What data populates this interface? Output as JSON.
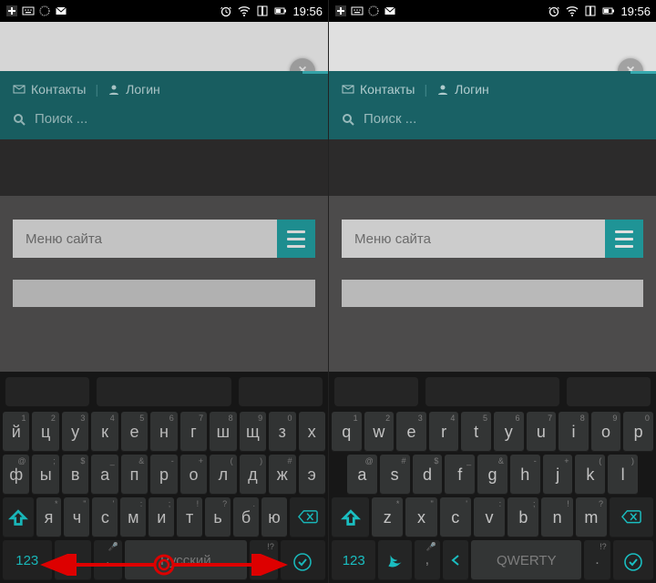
{
  "status": {
    "time": "19:56",
    "icons": {
      "plus": "+",
      "keyboard": "⌨",
      "circle": "◎",
      "mail": "✉",
      "alarm": "⏰",
      "wifi": "wifi",
      "signal": "📶",
      "sq": "▢",
      "bat": "🔋"
    }
  },
  "browser": {
    "close_label": "×"
  },
  "header": {
    "contacts": "Контакты",
    "login": "Логин",
    "search_placeholder": "Поиск ..."
  },
  "menu": {
    "label": "Меню сайта"
  },
  "keyboards": {
    "ru": {
      "row1": [
        {
          "l": "й",
          "s": "1"
        },
        {
          "l": "ц",
          "s": "2"
        },
        {
          "l": "у",
          "s": "3"
        },
        {
          "l": "к",
          "s": "4"
        },
        {
          "l": "е",
          "s": "5"
        },
        {
          "l": "н",
          "s": "6"
        },
        {
          "l": "г",
          "s": "7"
        },
        {
          "l": "ш",
          "s": "8"
        },
        {
          "l": "щ",
          "s": "9"
        },
        {
          "l": "з",
          "s": "0"
        },
        {
          "l": "х",
          "s": ""
        }
      ],
      "row2": [
        {
          "l": "ф",
          "s": "@"
        },
        {
          "l": "ы",
          "s": ";"
        },
        {
          "l": "в",
          "s": "$"
        },
        {
          "l": "а",
          "s": "_"
        },
        {
          "l": "п",
          "s": "&"
        },
        {
          "l": "р",
          "s": "-"
        },
        {
          "l": "о",
          "s": "+"
        },
        {
          "l": "л",
          "s": "("
        },
        {
          "l": "д",
          "s": ")"
        },
        {
          "l": "ж",
          "s": "#"
        },
        {
          "l": "э",
          "s": ""
        }
      ],
      "row3": [
        {
          "l": "я",
          "s": "*"
        },
        {
          "l": "ч",
          "s": "\""
        },
        {
          "l": "с",
          "s": "'"
        },
        {
          "l": "м",
          "s": ":"
        },
        {
          "l": "и",
          "s": ";"
        },
        {
          "l": "т",
          "s": "!"
        },
        {
          "l": "ь",
          "s": "?"
        },
        {
          "l": "б",
          "s": "."
        },
        {
          "l": "ю",
          "s": ""
        }
      ],
      "space": "Русский",
      "sym": "123",
      "rowB": {
        "comma": ",",
        "period": ".",
        "ques": "!?"
      }
    },
    "en": {
      "row1": [
        {
          "l": "q",
          "s": "1"
        },
        {
          "l": "w",
          "s": "2"
        },
        {
          "l": "e",
          "s": "3"
        },
        {
          "l": "r",
          "s": "4"
        },
        {
          "l": "t",
          "s": "5"
        },
        {
          "l": "y",
          "s": "6"
        },
        {
          "l": "u",
          "s": "7"
        },
        {
          "l": "i",
          "s": "8"
        },
        {
          "l": "o",
          "s": "9"
        },
        {
          "l": "p",
          "s": "0"
        }
      ],
      "row2": [
        {
          "l": "a",
          "s": "@"
        },
        {
          "l": "s",
          "s": "#"
        },
        {
          "l": "d",
          "s": "$"
        },
        {
          "l": "f",
          "s": "_"
        },
        {
          "l": "g",
          "s": "&"
        },
        {
          "l": "h",
          "s": "-"
        },
        {
          "l": "j",
          "s": "+"
        },
        {
          "l": "k",
          "s": "("
        },
        {
          "l": "l",
          "s": ")"
        }
      ],
      "row3": [
        {
          "l": "z",
          "s": "*"
        },
        {
          "l": "x",
          "s": "\""
        },
        {
          "l": "c",
          "s": "'"
        },
        {
          "l": "v",
          "s": ":"
        },
        {
          "l": "b",
          "s": ";"
        },
        {
          "l": "n",
          "s": "!"
        },
        {
          "l": "m",
          "s": "?"
        }
      ],
      "space": "QWERTY",
      "sym": "123",
      "rowB": {
        "comma": ",",
        "period": ".",
        "ques": "!?",
        "lang": "◀"
      }
    }
  }
}
